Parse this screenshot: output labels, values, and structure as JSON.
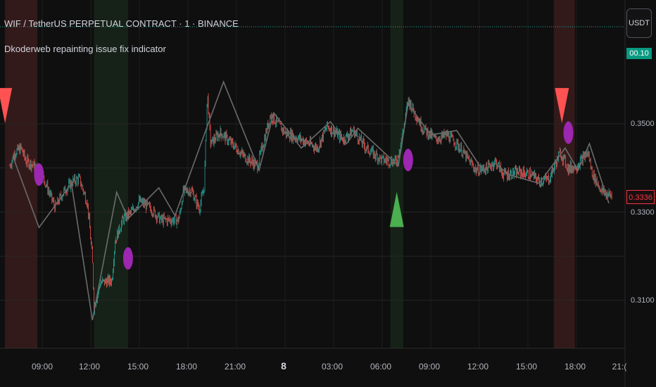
{
  "header": {
    "title": "WIF / TetherUS PERPETUAL CONTRACT · 1 · BINANCE",
    "subtitle": "Dkoderweb repainting issue fix indicator"
  },
  "price_axis": {
    "unit_button": "USDT",
    "last_price_tag": "0.3336",
    "upper_tag": "00.10"
  },
  "colors": {
    "background": "#0f0f0f",
    "candle_up": "#26a69a",
    "candle_down": "#ef5350",
    "zigzag": "#6b6b6b",
    "sell_arrow": "#ff5252",
    "buy_arrow": "#4caf50",
    "circle": "#9c27b0",
    "sell_zone": "#3a1c1c",
    "buy_zone": "#17261a",
    "dotted_line": "#26a69a"
  },
  "chart_data": {
    "type": "candlestick",
    "title": "WIF / TetherUS PERPETUAL CONTRACT · 1 · BINANCE",
    "ylim": [
      0.305,
      0.362
    ],
    "x_ticks": [
      "09:00",
      "12:00",
      "15:00",
      "18:00",
      "21:00",
      "8",
      "03:00",
      "06:00",
      "09:00",
      "12:00",
      "15:00",
      "18:00",
      "21:("
    ],
    "y_ticks": [
      0.35,
      0.33,
      0.31
    ],
    "y_tick_labels": [
      "0.3500",
      "0.3300",
      "0.3100"
    ],
    "price_path": [
      {
        "h": 7.0,
        "p": 0.3405
      },
      {
        "h": 7.3,
        "p": 0.3435
      },
      {
        "h": 7.7,
        "p": 0.3445
      },
      {
        "h": 8.0,
        "p": 0.3415
      },
      {
        "h": 8.4,
        "p": 0.3408
      },
      {
        "h": 9.0,
        "p": 0.3385
      },
      {
        "h": 9.8,
        "p": 0.331
      },
      {
        "h": 10.3,
        "p": 0.3345
      },
      {
        "h": 10.9,
        "p": 0.337
      },
      {
        "h": 11.3,
        "p": 0.3375
      },
      {
        "h": 11.8,
        "p": 0.332
      },
      {
        "h": 12.1,
        "p": 0.3195
      },
      {
        "h": 12.2,
        "p": 0.3085
      },
      {
        "h": 12.6,
        "p": 0.314
      },
      {
        "h": 13.3,
        "p": 0.3145
      },
      {
        "h": 13.5,
        "p": 0.3235
      },
      {
        "h": 14.0,
        "p": 0.3285
      },
      {
        "h": 14.5,
        "p": 0.33
      },
      {
        "h": 15.0,
        "p": 0.3325
      },
      {
        "h": 15.7,
        "p": 0.3308
      },
      {
        "h": 16.3,
        "p": 0.3282
      },
      {
        "h": 17.4,
        "p": 0.3282
      },
      {
        "h": 17.5,
        "p": 0.3295
      },
      {
        "h": 17.7,
        "p": 0.3345
      },
      {
        "h": 18.2,
        "p": 0.335
      },
      {
        "h": 18.7,
        "p": 0.3308
      },
      {
        "h": 19.0,
        "p": 0.3355
      },
      {
        "h": 19.2,
        "p": 0.357
      },
      {
        "h": 19.4,
        "p": 0.3455
      },
      {
        "h": 20.0,
        "p": 0.348
      },
      {
        "h": 21.0,
        "p": 0.3445
      },
      {
        "h": 21.5,
        "p": 0.3425
      },
      {
        "h": 22.3,
        "p": 0.3405
      },
      {
        "h": 23.1,
        "p": 0.352
      },
      {
        "h": 24.0,
        "p": 0.348
      },
      {
        "h": 25.0,
        "p": 0.3465
      },
      {
        "h": 26.0,
        "p": 0.3445
      },
      {
        "h": 26.6,
        "p": 0.3495
      },
      {
        "h": 27.6,
        "p": 0.3465
      },
      {
        "h": 28.2,
        "p": 0.3485
      },
      {
        "h": 29.0,
        "p": 0.3445
      },
      {
        "h": 30.0,
        "p": 0.3418
      },
      {
        "h": 30.9,
        "p": 0.3415
      },
      {
        "h": 31.4,
        "p": 0.3505
      },
      {
        "h": 31.6,
        "p": 0.3555
      },
      {
        "h": 32.5,
        "p": 0.349
      },
      {
        "h": 33.3,
        "p": 0.3465
      },
      {
        "h": 34.0,
        "p": 0.3475
      },
      {
        "h": 34.6,
        "p": 0.3455
      },
      {
        "h": 35.2,
        "p": 0.3425
      },
      {
        "h": 35.8,
        "p": 0.3395
      },
      {
        "h": 36.5,
        "p": 0.34
      },
      {
        "h": 37.0,
        "p": 0.3415
      },
      {
        "h": 37.5,
        "p": 0.3385
      },
      {
        "h": 38.5,
        "p": 0.339
      },
      {
        "h": 39.2,
        "p": 0.3385
      },
      {
        "h": 39.7,
        "p": 0.337
      },
      {
        "h": 40.3,
        "p": 0.3375
      },
      {
        "h": 41.0,
        "p": 0.3435
      },
      {
        "h": 41.5,
        "p": 0.3398
      },
      {
        "h": 42.0,
        "p": 0.3405
      },
      {
        "h": 42.7,
        "p": 0.3435
      },
      {
        "h": 43.0,
        "p": 0.3385
      },
      {
        "h": 43.6,
        "p": 0.3345
      },
      {
        "h": 44.2,
        "p": 0.3336
      }
    ],
    "zigzag": [
      {
        "h": 7.2,
        "p": 0.3425
      },
      {
        "h": 8.8,
        "p": 0.3265
      },
      {
        "h": 10.8,
        "p": 0.3365
      },
      {
        "h": 12.1,
        "p": 0.3055
      },
      {
        "h": 13.6,
        "p": 0.3345
      },
      {
        "h": 14.3,
        "p": 0.3285
      },
      {
        "h": 16.2,
        "p": 0.3355
      },
      {
        "h": 17.2,
        "p": 0.3292
      },
      {
        "h": 19.3,
        "p": 0.3505
      },
      {
        "h": 20.2,
        "p": 0.3595
      },
      {
        "h": 22.4,
        "p": 0.3395
      },
      {
        "h": 23.3,
        "p": 0.3525
      },
      {
        "h": 25.0,
        "p": 0.3445
      },
      {
        "h": 26.8,
        "p": 0.3505
      },
      {
        "h": 27.8,
        "p": 0.3455
      },
      {
        "h": 28.5,
        "p": 0.349
      },
      {
        "h": 31.0,
        "p": 0.3405
      },
      {
        "h": 31.6,
        "p": 0.3545
      },
      {
        "h": 33.0,
        "p": 0.3475
      },
      {
        "h": 34.6,
        "p": 0.3485
      },
      {
        "h": 36.2,
        "p": 0.3395
      },
      {
        "h": 37.0,
        "p": 0.341
      },
      {
        "h": 37.8,
        "p": 0.3385
      },
      {
        "h": 39.7,
        "p": 0.3365
      },
      {
        "h": 41.3,
        "p": 0.3445
      },
      {
        "h": 42.1,
        "p": 0.3395
      },
      {
        "h": 42.8,
        "p": 0.3455
      },
      {
        "h": 44.0,
        "p": 0.332
      }
    ],
    "signals": [
      {
        "type": "sell",
        "h": 6.7,
        "p": 0.3538
      },
      {
        "type": "sell",
        "h": 41.1,
        "p": 0.3538
      },
      {
        "type": "buy",
        "h": 30.9,
        "p": 0.3306
      }
    ],
    "markers": [
      {
        "h": 8.8,
        "p": 0.3385
      },
      {
        "h": 14.3,
        "p": 0.3195
      },
      {
        "h": 31.6,
        "p": 0.3418
      },
      {
        "h": 41.5,
        "p": 0.348
      }
    ],
    "zones": [
      {
        "type": "sell",
        "h0": 6.7,
        "h1": 8.7
      },
      {
        "type": "buy",
        "h0": 12.2,
        "h1": 14.3
      },
      {
        "type": "buy",
        "h0": 30.5,
        "h1": 31.3
      },
      {
        "type": "sell",
        "h0": 40.6,
        "h1": 41.9
      }
    ],
    "grid": true
  }
}
